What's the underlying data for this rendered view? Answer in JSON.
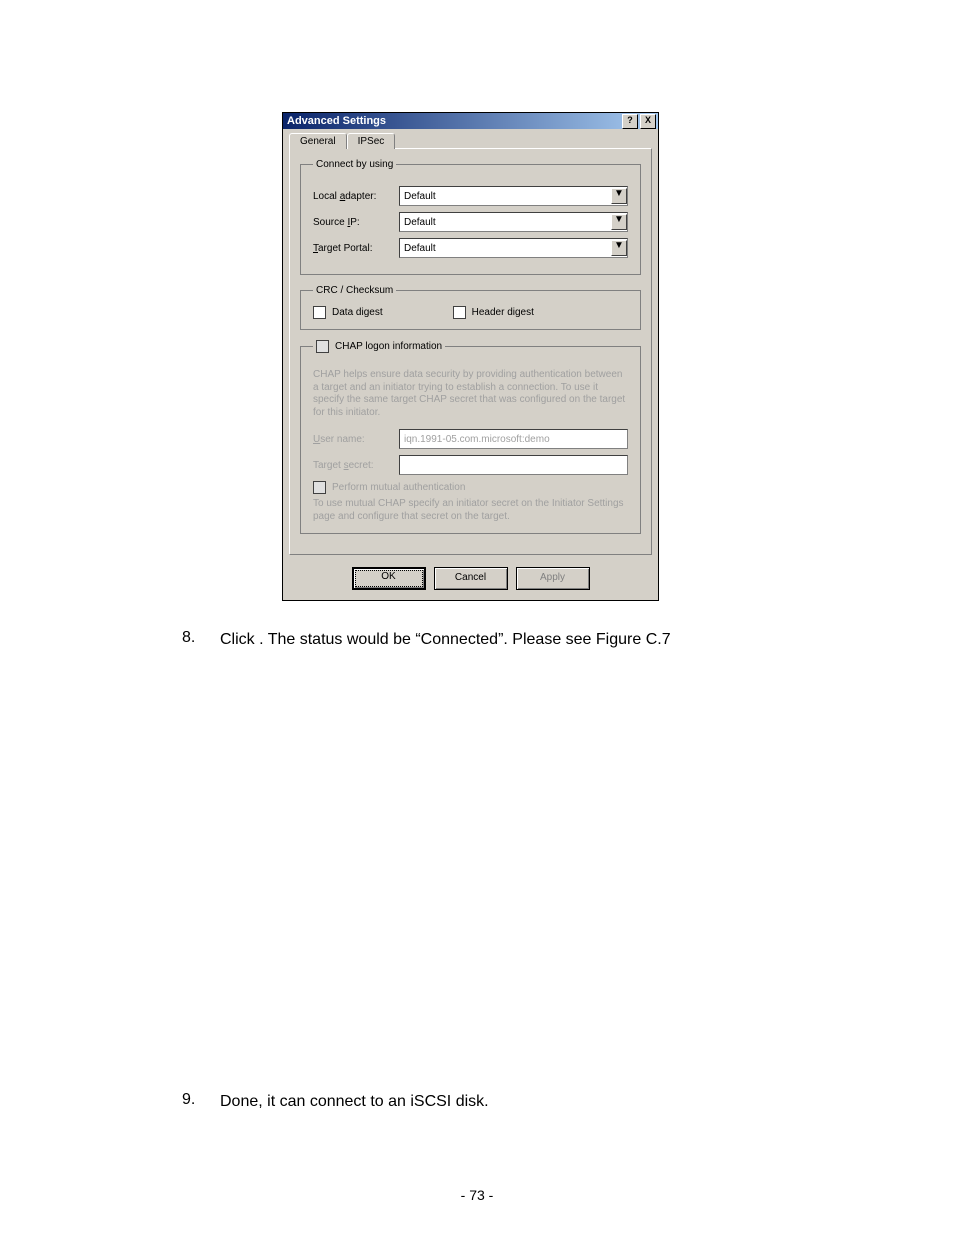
{
  "dialog": {
    "title": "Advanced Settings",
    "help_btn": "?",
    "close_btn": "X",
    "tabs": {
      "general": "General",
      "ipsec": "IPSec"
    },
    "connect": {
      "legend": "Connect by using",
      "local_adapter_label_pre": "Local ",
      "local_adapter_label_ul": "a",
      "local_adapter_label_post": "dapter:",
      "local_adapter_value": "Default",
      "source_ip_label_pre": "Source ",
      "source_ip_label_ul": "I",
      "source_ip_label_post": "P:",
      "source_ip_value": "Default",
      "target_portal_label_ul": "T",
      "target_portal_label_post": "arget Portal:",
      "target_portal_value": "Default"
    },
    "crc": {
      "legend": "CRC / Checksum",
      "data_digest_ul": "D",
      "data_digest_post": "ata digest",
      "header_digest_ul": "H",
      "header_digest_post": "eader digest"
    },
    "chap": {
      "legend_ul": "C",
      "legend_post": "HAP logon information",
      "help_text": "CHAP helps ensure data security by providing authentication between a target and an initiator trying to establish a connection. To use it specify the same target CHAP secret that was configured on the target for this initiator.",
      "user_label_ul": "U",
      "user_label_post": "ser name:",
      "user_value": "iqn.1991-05.com.microsoft:demo",
      "secret_label_pre": "Target ",
      "secret_label_ul": "s",
      "secret_label_post": "ecret:",
      "secret_value": "",
      "mutual_ul": "P",
      "mutual_post": "erform mutual authentication",
      "mutual_help": "To use mutual CHAP specify an initiator secret on the Initiator Settings page and configure that secret on the target."
    },
    "buttons": {
      "ok": "OK",
      "cancel": "Cancel",
      "apply": "Apply"
    }
  },
  "doc": {
    "step8_num": "8.",
    "step8_text": "Click         . The status would be “Connected”. Please see Figure C.7",
    "step9_num": "9.",
    "step9_text": "Done, it can connect to an iSCSI disk.",
    "page_number": "- 73 -"
  }
}
